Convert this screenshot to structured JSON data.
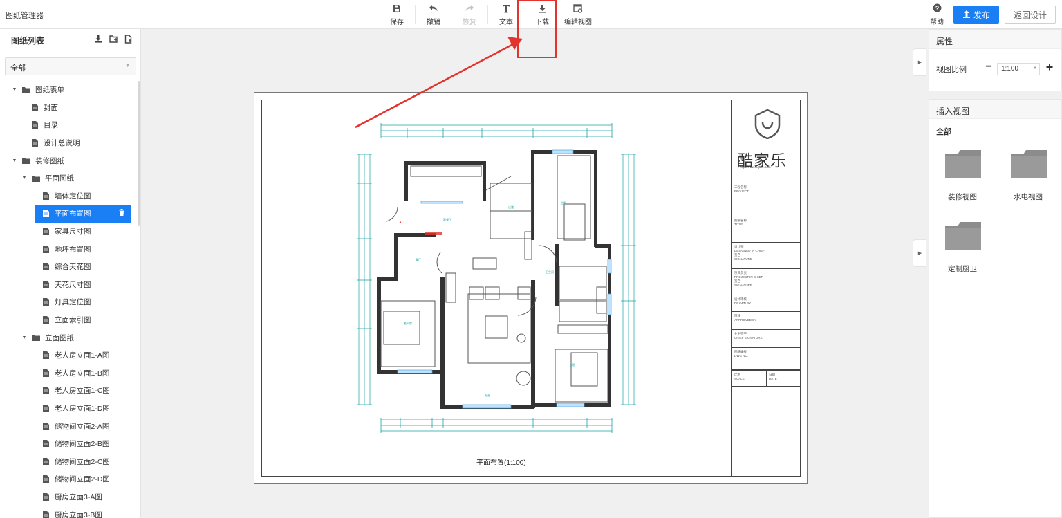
{
  "app": {
    "title": "图纸管理器"
  },
  "toolbar": {
    "items": [
      {
        "label": "保存",
        "icon": "save-icon",
        "enabled": true
      },
      {
        "label": "撤销",
        "icon": "undo-icon",
        "enabled": true
      },
      {
        "label": "恢复",
        "icon": "redo-icon",
        "enabled": false
      },
      {
        "label": "文本",
        "icon": "text-icon",
        "enabled": true
      },
      {
        "label": "下载",
        "icon": "download-icon",
        "enabled": true
      },
      {
        "label": "编辑视图",
        "icon": "edit-view-icon",
        "enabled": true
      }
    ],
    "help_label": "帮助",
    "publish_label": "发布",
    "back_label": "返回设计"
  },
  "sidebar": {
    "title": "图纸列表",
    "filter_value": "全部",
    "tree": [
      {
        "label": "图纸表单",
        "type": "folder",
        "level": 0,
        "expanded": true
      },
      {
        "label": "封面",
        "type": "file",
        "level": 1
      },
      {
        "label": "目录",
        "type": "file",
        "level": 1
      },
      {
        "label": "设计总说明",
        "type": "file",
        "level": 1
      },
      {
        "label": "装修图纸",
        "type": "folder",
        "level": 0,
        "expanded": true
      },
      {
        "label": "平面图纸",
        "type": "folder",
        "level": 1,
        "expanded": true
      },
      {
        "label": "墙体定位图",
        "type": "file",
        "level": 2
      },
      {
        "label": "平面布置图",
        "type": "file",
        "level": 2,
        "selected": true
      },
      {
        "label": "家具尺寸图",
        "type": "file",
        "level": 2
      },
      {
        "label": "地坪布置图",
        "type": "file",
        "level": 2
      },
      {
        "label": "综合天花图",
        "type": "file",
        "level": 2
      },
      {
        "label": "天花尺寸图",
        "type": "file",
        "level": 2
      },
      {
        "label": "灯具定位图",
        "type": "file",
        "level": 2
      },
      {
        "label": "立面索引图",
        "type": "file",
        "level": 2
      },
      {
        "label": "立面图纸",
        "type": "folder",
        "level": 1,
        "expanded": true
      },
      {
        "label": "老人房立面1-A图",
        "type": "file",
        "level": 2
      },
      {
        "label": "老人房立面1-B图",
        "type": "file",
        "level": 2
      },
      {
        "label": "老人房立面1-C图",
        "type": "file",
        "level": 2
      },
      {
        "label": "老人房立面1-D图",
        "type": "file",
        "level": 2
      },
      {
        "label": "储物间立面2-A图",
        "type": "file",
        "level": 2
      },
      {
        "label": "储物间立面2-B图",
        "type": "file",
        "level": 2
      },
      {
        "label": "储物间立面2-C图",
        "type": "file",
        "level": 2
      },
      {
        "label": "储物间立面2-D图",
        "type": "file",
        "level": 2
      },
      {
        "label": "厨房立面3-A图",
        "type": "file",
        "level": 2
      },
      {
        "label": "厨房立面3-B图",
        "type": "file",
        "level": 2
      }
    ]
  },
  "drawing": {
    "caption": "平面布置(1:100)",
    "logo_text": "酷家乐",
    "logo_url": "http://www.kujiale.com",
    "title_block": [
      {
        "cn": "工程名称",
        "en": "PROJECT"
      },
      {
        "cn": "图纸名称",
        "en": "TITLE"
      },
      {
        "cn": "设计师",
        "en": "DESIGNED IN CHIEF",
        "cn2": "签名",
        "en2": "SIGNATURE"
      },
      {
        "cn": "项目负责",
        "en": "PROJECT IN CHIEF",
        "cn2": "签名",
        "en2": "SIGNATURE"
      },
      {
        "cn": "设计审核",
        "en": "DRAWN BY"
      },
      {
        "cn": "审核",
        "en": "APPROVED BY"
      },
      {
        "cn": "业主签字",
        "en": "CHIEF SIGNATURE"
      },
      {
        "cn": "图纸编号",
        "en": "DWG NO."
      },
      {
        "cn": "比例",
        "en": "SCALE",
        "cn2": "日期",
        "en2": "DATE"
      }
    ]
  },
  "properties": {
    "title": "属性",
    "scale_label": "视图比例",
    "scale_value": "1:100"
  },
  "insert_views": {
    "title": "插入视图",
    "filter": "全部",
    "items": [
      {
        "label": "装修视图"
      },
      {
        "label": "水电视图"
      },
      {
        "label": "定制厨卫"
      }
    ]
  },
  "colors": {
    "accent": "#1a7ff5",
    "annotation": "#e2332e",
    "dimension": "#1aa3a3",
    "folder": "#8c8c8c"
  }
}
